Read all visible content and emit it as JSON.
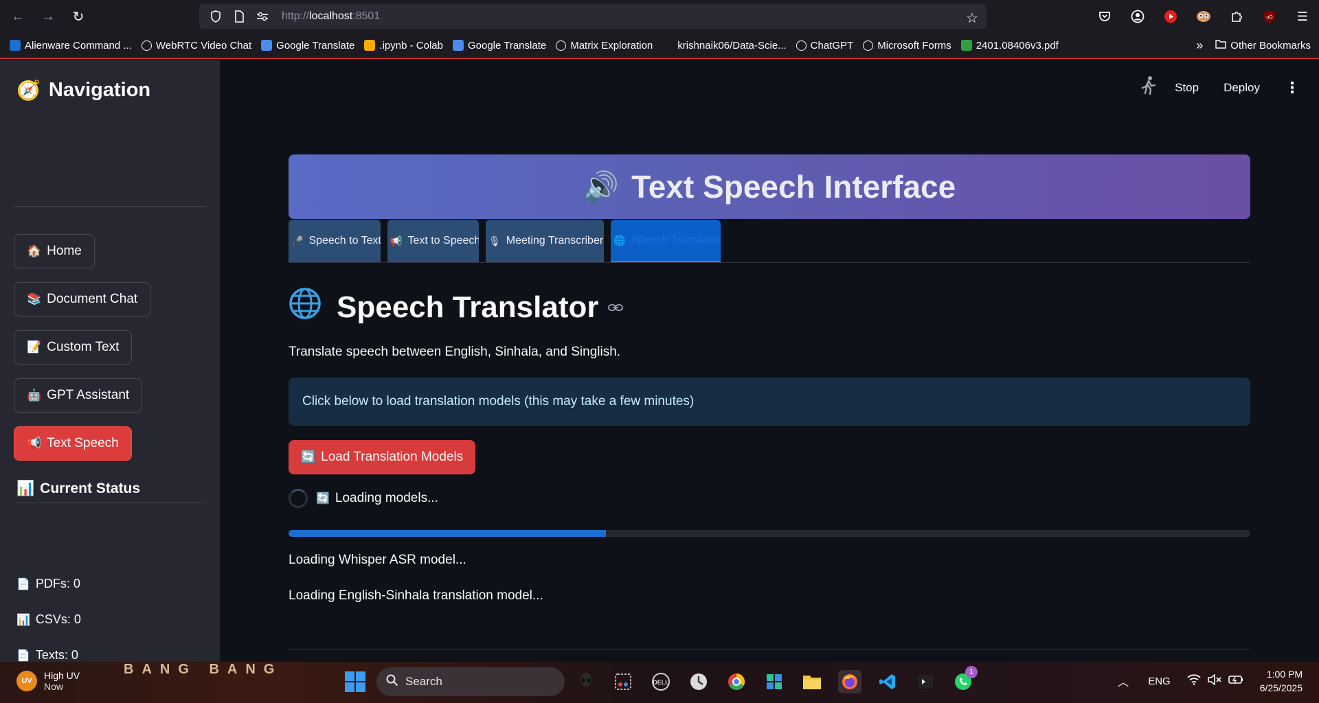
{
  "browser": {
    "url_prefix": "http://",
    "url_host": "localhost",
    "url_port": ":8501"
  },
  "bookmarks": [
    {
      "label": "Alienware Command ...",
      "icon": "dell-icon",
      "color": "#1a6fd0"
    },
    {
      "label": "WebRTC Video Chat",
      "icon": "globe-icon",
      "color": "#fbfbfe"
    },
    {
      "label": "Google Translate",
      "icon": "google-translate-icon",
      "color": "#4a8cf0"
    },
    {
      "label": ".ipynb - Colab",
      "icon": "colab-icon",
      "color": "#f9ab00"
    },
    {
      "label": "Google Translate",
      "icon": "google-translate-icon",
      "color": "#4a8cf0"
    },
    {
      "label": "Matrix Exploration",
      "icon": "globe-icon",
      "color": "#fbfbfe"
    },
    {
      "label": "krishnaik06/Data-Scie...",
      "icon": "github-icon",
      "color": "#1c1b22"
    },
    {
      "label": "ChatGPT",
      "icon": "chatgpt-icon",
      "color": "#fbfbfe"
    },
    {
      "label": "Microsoft Forms",
      "icon": "globe-icon",
      "color": "#fbfbfe"
    },
    {
      "label": "2401.08406v3.pdf",
      "icon": "pdf-icon",
      "color": "#2ea043"
    }
  ],
  "other_bookmarks": "Other Bookmarks",
  "sidebar": {
    "title": "Navigation",
    "buttons": [
      {
        "label": "Home",
        "icon": "🏠"
      },
      {
        "label": "Document Chat",
        "icon": "📚"
      },
      {
        "label": "Custom Text",
        "icon": "📝"
      },
      {
        "label": "GPT Assistant",
        "icon": "🤖"
      },
      {
        "label": "Text Speech",
        "icon": "📢"
      }
    ],
    "status_title": "Current Status",
    "status": [
      {
        "label": "PDFs: 0",
        "icon": "📄"
      },
      {
        "label": "CSVs: 0",
        "icon": "📊"
      },
      {
        "label": "Texts: 0",
        "icon": "📄"
      }
    ]
  },
  "header": {
    "stop": "Stop",
    "deploy": "Deploy"
  },
  "banner": {
    "title": "Text Speech Interface",
    "icon": "🔊"
  },
  "tabs": [
    {
      "label": "Speech to Text",
      "icon": "🎤"
    },
    {
      "label": "Text to Speech",
      "icon": "📢"
    },
    {
      "label": "Meeting Transcriber",
      "icon": "🎙"
    },
    {
      "label": "Speech Translator",
      "icon": "🌐"
    }
  ],
  "page": {
    "title": "Speech Translator",
    "description": "Translate speech between English, Sinhala, and Singlish.",
    "info": "Click below to load translation models (this may take a few minutes)",
    "load_button": "Load Translation Models",
    "loading": "Loading models...",
    "progress": 0.33,
    "log": [
      "Loading Whisper ASR model...",
      "Loading English-Sinhala translation model..."
    ]
  },
  "taskbar": {
    "weather_badge": "UV",
    "weather_title": "High UV",
    "weather_sub": "Now",
    "wallpaper_text": "BANG BANG",
    "search": "Search",
    "lang": "ENG",
    "time": "1:00 PM",
    "date": "6/25/2025",
    "whatsapp_badge": "1"
  },
  "colors": {
    "accent": "#ff4b4b",
    "sidebar_bg": "#262730",
    "main_bg": "#0e1117",
    "progress": "#1b6fd0"
  }
}
